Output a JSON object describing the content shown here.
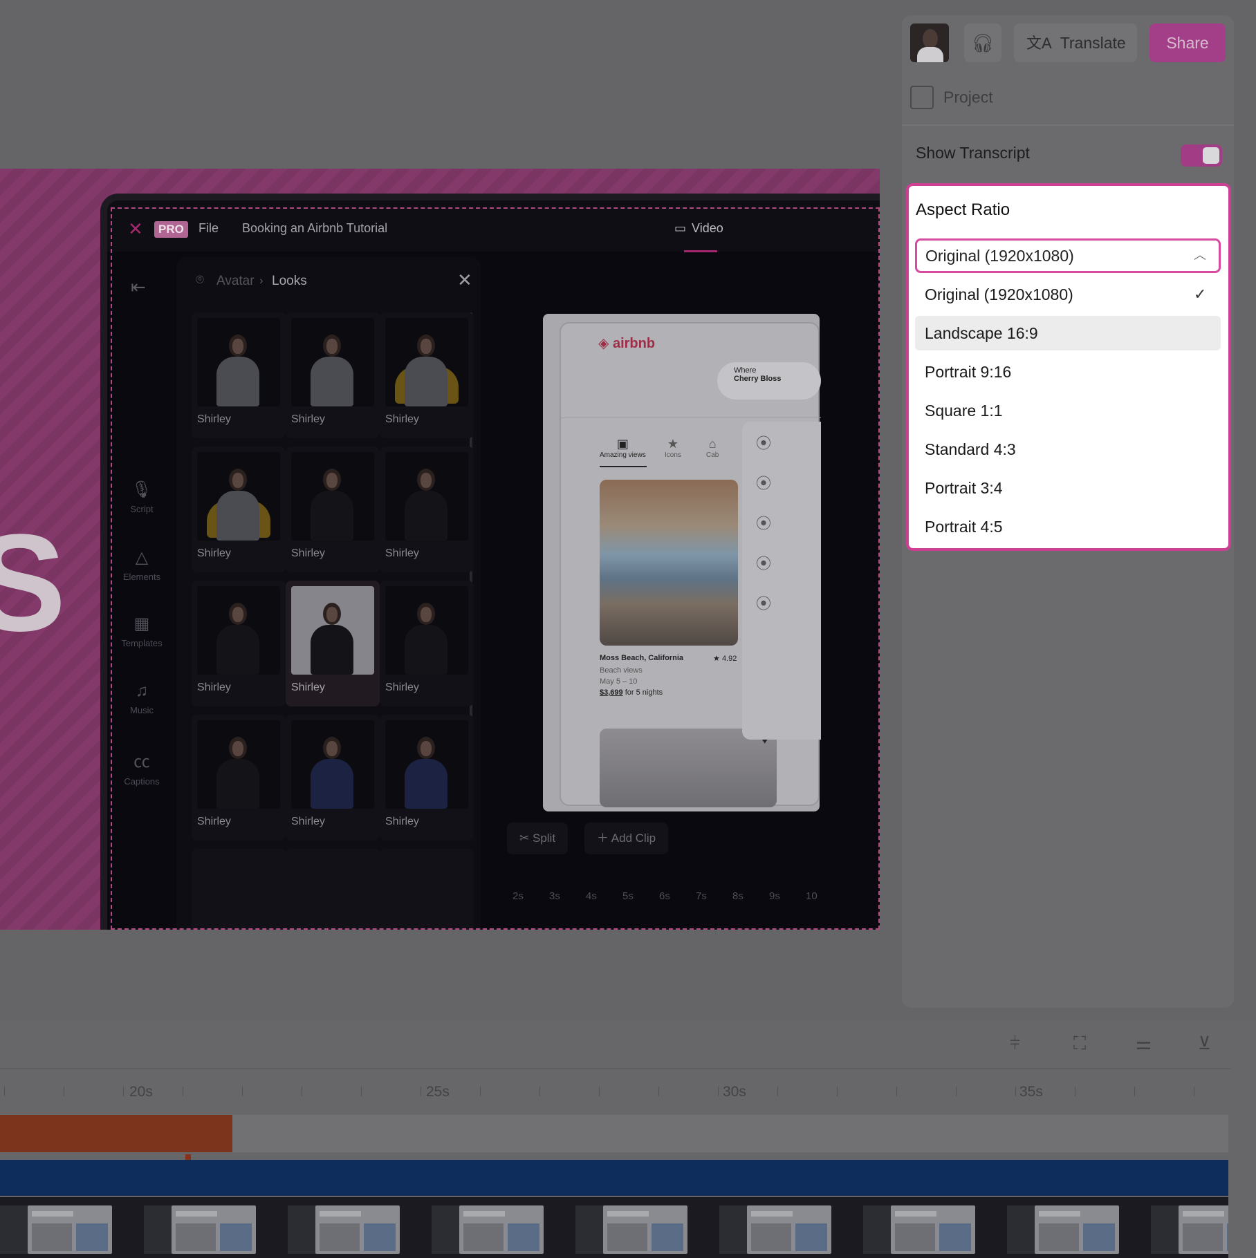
{
  "topbar": {
    "translate_label": "Translate",
    "share_label": "Share"
  },
  "project": {
    "label": "Project"
  },
  "transcript": {
    "label": "Show Transcript",
    "enabled": true
  },
  "aspect_ratio": {
    "title": "Aspect Ratio",
    "selected": "Original (1920x1080)",
    "options": [
      "Original (1920x1080)",
      "Landscape 16:9",
      "Portrait 9:16",
      "Square 1:1",
      "Standard 4:3",
      "Portrait 3:4",
      "Portrait 4:5"
    ],
    "highlighted": "Landscape 16:9"
  },
  "canvas": {
    "big_letter": "S",
    "app": {
      "badge": "PRO",
      "file_menu": "File",
      "project_title": "Booking an Airbnb Tutorial",
      "video_tab": "Video",
      "breadcrumb_parent": "Avatar",
      "breadcrumb_current": "Looks",
      "nav": [
        "Script",
        "Elements",
        "Templates",
        "Music",
        "Captions"
      ],
      "looks": [
        "Shirley",
        "Shirley",
        "Shirley",
        "Shirley",
        "Shirley",
        "Shirley",
        "Shirley",
        "Shirley",
        "Shirley",
        "Shirley",
        "Shirley",
        "Shirley"
      ],
      "split_label": "Split",
      "add_clip_label": "Add Clip",
      "scale": [
        "2s",
        "3s",
        "4s",
        "5s",
        "6s",
        "7s",
        "8s",
        "9s",
        "10"
      ],
      "airbnb": {
        "brand": "airbnb",
        "search_where": "Where",
        "search_value": "Cherry Bloss",
        "tabs": [
          "Amazing views",
          "Icons",
          "Cab"
        ],
        "listing_title": "Moss Beach, California",
        "listing_rating": "4.92",
        "listing_sub": "Beach views",
        "listing_dates": "May 5 – 10",
        "listing_price": "$3,699",
        "listing_price_suffix": "for 5 nights"
      }
    }
  },
  "timeline": {
    "ticks": [
      "20s",
      "25s",
      "30s",
      "35s"
    ]
  },
  "colors": {
    "accent": "#cc3f95",
    "share_bg": "#a33e88",
    "overlay": "#656567"
  }
}
